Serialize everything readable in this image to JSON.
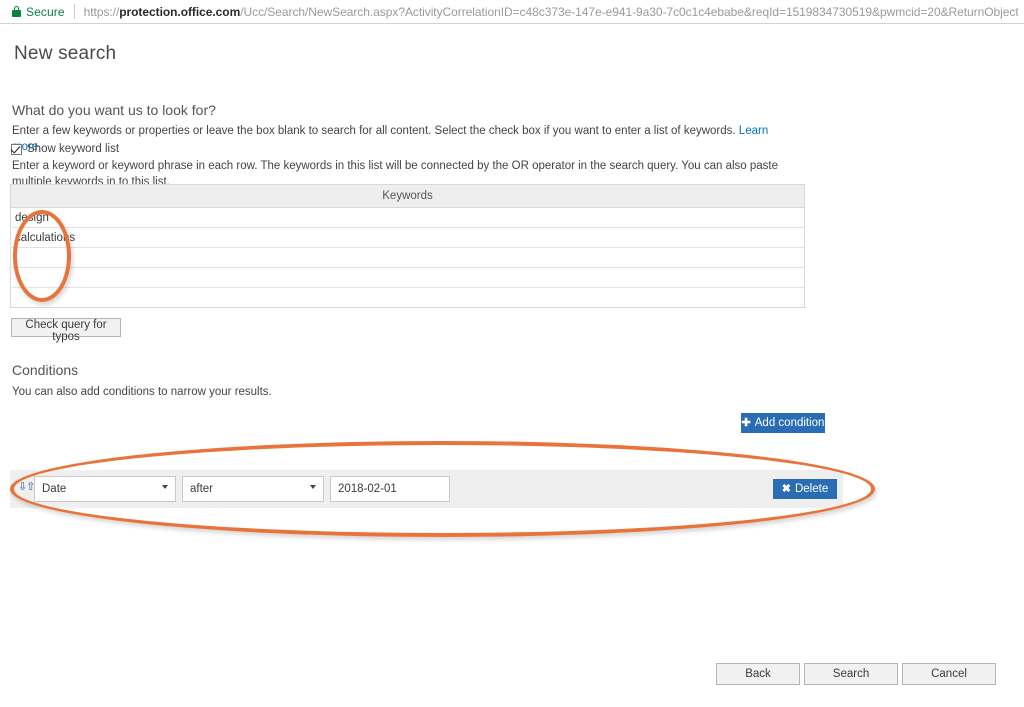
{
  "browser": {
    "security_label": "Secure",
    "lock_icon": "lock-icon",
    "url_scheme": "https://",
    "url_host": "protection.office.com",
    "url_path": "/Ucc/Search/NewSearch.aspx?ActivityCorrelationID=c48c373e-147e-e941-9a30-7c0c1c4ebabe&reqId=1519834730519&pwmcid=20&ReturnObjectTy..."
  },
  "page": {
    "title": "New search"
  },
  "keywords_section": {
    "heading": "What do you want us to look for?",
    "description": "Enter a few keywords or properties or leave the box blank to search for all content. Select the check box if you want to enter a list of keywords.",
    "learn_more": "Learn more",
    "checkbox_label": "Show keyword list",
    "checkbox_checked": true,
    "list_help": "Enter a keyword or keyword phrase in each row. The keywords in this list will be connected by the OR operator in the search query. You can also paste multiple keywords in to this list.",
    "table": {
      "column_header": "Keywords",
      "rows": [
        "design",
        "calculations",
        "",
        "",
        ""
      ]
    },
    "typo_button": "Check query for typos"
  },
  "conditions_section": {
    "heading": "Conditions",
    "description": "You can also add conditions to narrow your results.",
    "add_button": {
      "label": "Add condition",
      "icon": "plus-icon"
    },
    "rows": [
      {
        "sort_icon": "sort-updown-icon",
        "field": "Date",
        "operator": "after",
        "value": "2018-02-01",
        "delete_button": {
          "label": "Delete",
          "icon": "close-x-icon"
        }
      }
    ]
  },
  "footer": {
    "back": "Back",
    "search": "Search",
    "cancel": "Cancel"
  },
  "annotations": [
    {
      "name": "keywords-highlight",
      "color": "#e8743b"
    },
    {
      "name": "conditions-highlight",
      "color": "#e8743b"
    }
  ],
  "colors": {
    "accent_blue": "#2a6db5",
    "link_blue": "#0072c6",
    "secure_green": "#0b8043",
    "annotation_orange": "#e8743b",
    "row_gray": "#efefef",
    "header_gray": "#eeeeee"
  }
}
